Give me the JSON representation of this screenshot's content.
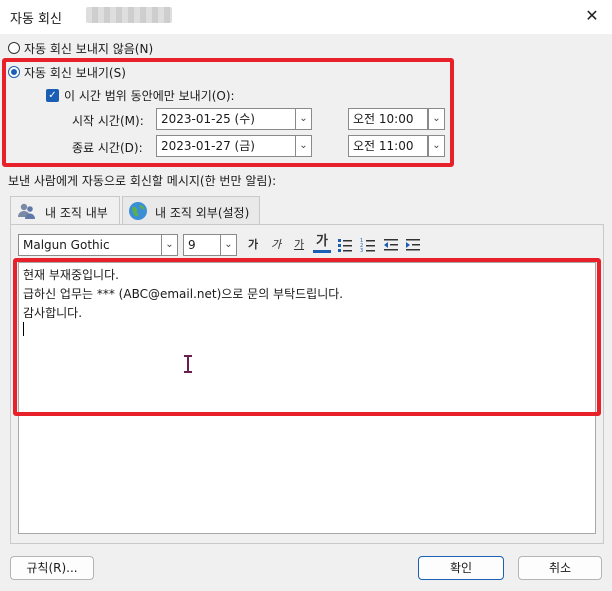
{
  "window": {
    "title": "자동 회신",
    "close_glyph": "✕"
  },
  "options": {
    "no_auto_reply": "자동 회신 보내지 않음(N)",
    "send_auto_reply": "자동 회신 보내기(S)",
    "only_time_range": "이 시간 범위 동안에만 보내기(O):",
    "start_label": "시작 시간(M):",
    "end_label": "종료 시간(D):",
    "start_date": "2023-01-25 (수)",
    "start_time": "오전 10:00",
    "end_date": "2023-01-27 (금)",
    "end_time": "오전 11:00"
  },
  "message_section_label": "보낸 사람에게 자동으로 회신할 메시지(한 번만 알림):",
  "tabs": [
    {
      "label": "내 조직 내부",
      "icon": "people-icon"
    },
    {
      "label": "내 조직 외부(설정)",
      "icon": "globe-icon"
    }
  ],
  "toolbar": {
    "font": "Malgun Gothic",
    "size": "9",
    "bold": "가",
    "italic": "가",
    "underline": "가",
    "color": "가"
  },
  "message_lines": [
    "현재 부재중입니다.",
    "급하신 업무는 *** (ABC@email.net)으로 문의 부탁드립니다.",
    "감사합니다."
  ],
  "buttons": {
    "rules": "규칙(R)...",
    "ok": "확인",
    "cancel": "취소"
  },
  "colors": {
    "accent": "#1a5fb4",
    "highlight": "#e8202a"
  }
}
